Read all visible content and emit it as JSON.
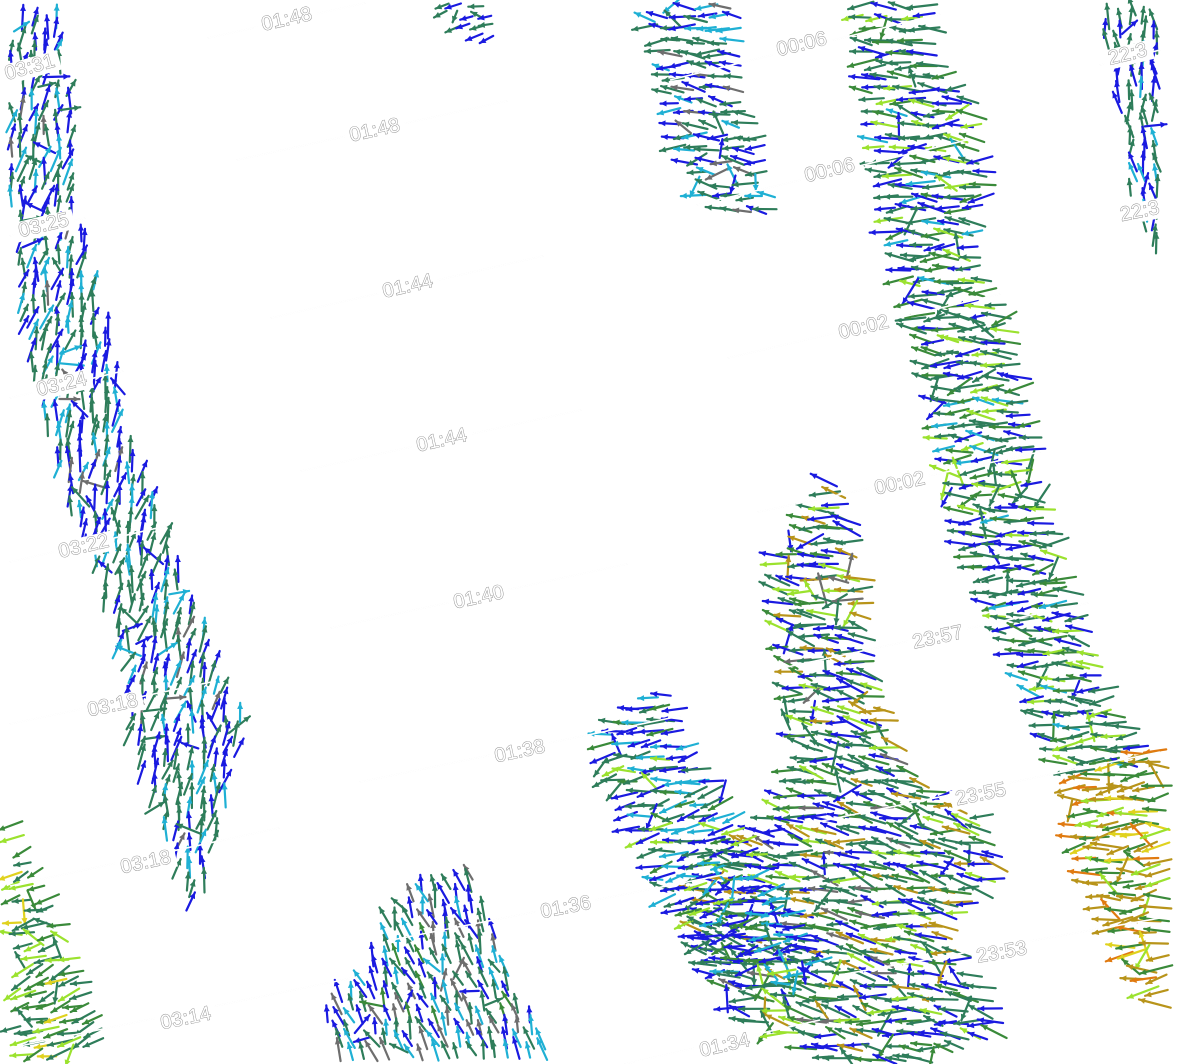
{
  "colors": {
    "background": "#ffffff",
    "track": "#9a9a9a",
    "label_stroke": "#8a8a8a",
    "vector_palette": {
      "blue": "#1a1ae0",
      "cyan": "#1fb0d4",
      "teal": "#2e7d5a",
      "green": "#3a8a3a",
      "lime": "#9be22e",
      "yellow": "#e0d21e",
      "olive": "#b8941a",
      "orange": "#e07a10",
      "gray": "#6e6e6e"
    }
  },
  "tracks": [
    {
      "label": "01:48",
      "group": "center"
    },
    {
      "label": "01:48",
      "group": "center"
    },
    {
      "label": "01:44",
      "group": "center"
    },
    {
      "label": "01:44",
      "group": "center"
    },
    {
      "label": "01:40",
      "group": "center"
    },
    {
      "label": "01:38",
      "group": "center"
    },
    {
      "label": "01:36",
      "group": "center"
    },
    {
      "label": "01:34",
      "group": "center"
    },
    {
      "label": "03:31",
      "group": "left"
    },
    {
      "label": "03:25",
      "group": "left"
    },
    {
      "label": "03:24",
      "group": "left"
    },
    {
      "label": "03:22",
      "group": "left"
    },
    {
      "label": "03:18",
      "group": "left"
    },
    {
      "label": "03:18",
      "group": "left"
    },
    {
      "label": "03:14",
      "group": "left"
    },
    {
      "label": "00:06",
      "group": "right"
    },
    {
      "label": "00:06",
      "group": "right"
    },
    {
      "label": "00:02",
      "group": "right"
    },
    {
      "label": "00:02",
      "group": "right"
    },
    {
      "label": "23:57",
      "group": "right"
    },
    {
      "label": "23:55",
      "group": "right"
    },
    {
      "label": "23:53",
      "group": "right"
    },
    {
      "label": "22:3",
      "group": "far-right"
    },
    {
      "label": "22:3",
      "group": "far-right"
    }
  ],
  "vector_swaths": [
    {
      "name": "left-swath",
      "dominant_direction_deg": 80
    },
    {
      "name": "top-center-swath",
      "dominant_direction_deg": 200
    },
    {
      "name": "upper-right-swath",
      "dominant_direction_deg": 175
    },
    {
      "name": "right-main-swath",
      "dominant_direction_deg": 180
    },
    {
      "name": "center-right-swath",
      "dominant_direction_deg": 170
    },
    {
      "name": "lower-center-swath",
      "dominant_direction_deg": 190
    },
    {
      "name": "bottom-center-swath",
      "dominant_direction_deg": 110
    },
    {
      "name": "far-right-swath",
      "dominant_direction_deg": 95
    },
    {
      "name": "bottom-left-swath",
      "dominant_direction_deg": 200
    }
  ]
}
